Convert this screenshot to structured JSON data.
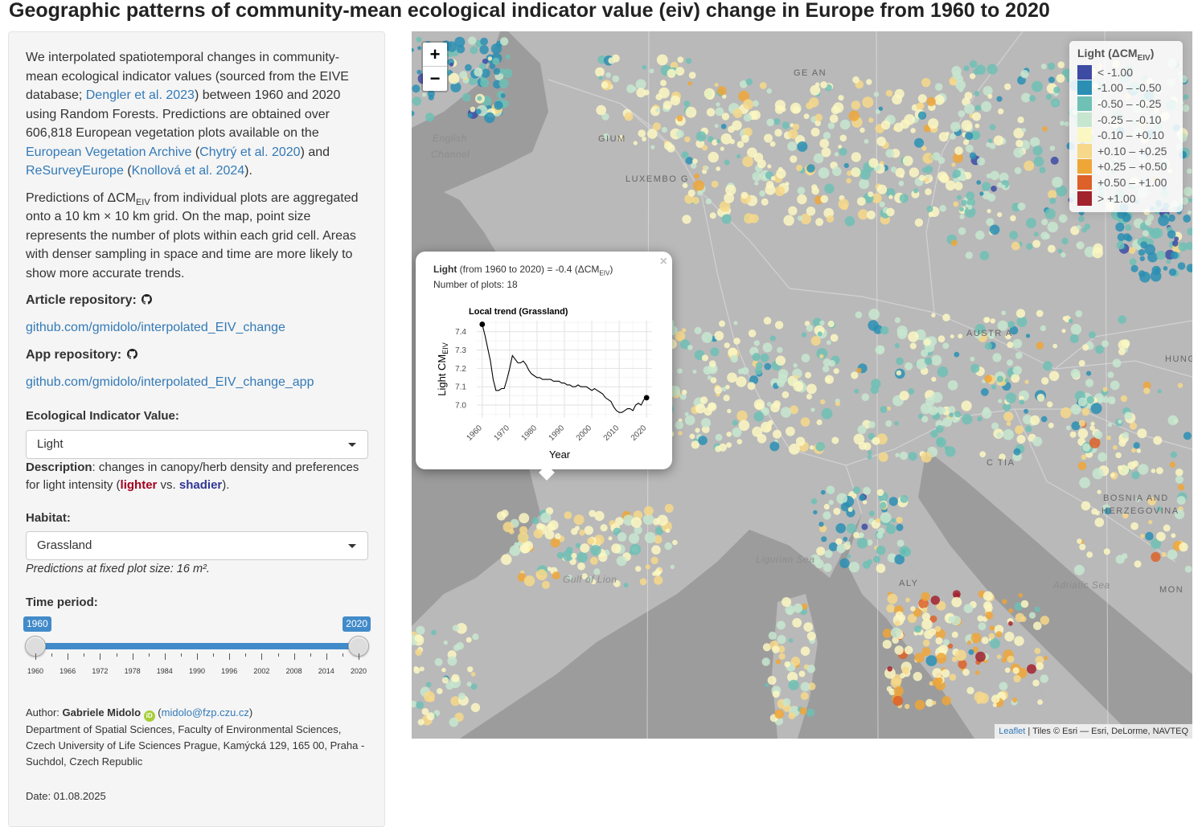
{
  "page": {
    "title": "Geographic patterns of community-mean ecological indicator value (eiv) change in Europe from 1960 to 2020"
  },
  "sidebar": {
    "intro": {
      "t1": "We interpolated spatiotemporal changes in community-mean ecological indicator values (sourced from the EIVE database; ",
      "link_dengler": "Dengler et al. 2023",
      "t2": ") between 1960 and 2020 using Random Forests. Predictions are obtained over 606,818 European vegetation plots available on the ",
      "link_eva": "European Vegetation Archive",
      "t3": " (",
      "link_chytry": "Chytrý et al. 2020",
      "t4": ") and ",
      "link_resurvey": "ReSurveyEurope",
      "t5": " (",
      "link_knollova": "Knollová et al. 2024",
      "t6": ")."
    },
    "aggregation": {
      "t1": "Predictions of ΔCM",
      "sub": "EIV",
      "t2": " from individual plots are aggregated onto a 10 km × 10 km grid. On the map, point size represents the number of plots within each grid cell. Areas with denser sampling in space and time are more likely to show more accurate trends."
    },
    "article_repo_label": "Article repository",
    "article_repo_link": "github.com/gmidolo/interpolated_EIV_change",
    "app_repo_label": "App repository",
    "app_repo_link": "github.com/gmidolo/interpolated_EIV_change_app",
    "eiv_label": "Ecological Indicator Value:",
    "eiv_selected": "Light",
    "description": {
      "label": "Description",
      "t1": ": changes in canopy/herb density and preferences for light intensity (",
      "lighter": "lighter",
      "vs": " vs. ",
      "shadier": "shadier",
      "end": ")."
    },
    "habitat_label": "Habitat:",
    "habitat_selected": "Grassland",
    "fixed_size_note": "Predictions at fixed plot size: 16 m².",
    "time_label": "Time period:",
    "slider": {
      "min": 1960,
      "max": 2020,
      "from_label": "1960",
      "to_label": "2020",
      "ticks": [
        "1960",
        "1966",
        "1972",
        "1978",
        "1984",
        "1990",
        "1996",
        "2002",
        "2008",
        "2014",
        "2020"
      ]
    },
    "author": {
      "prefix": "Author: ",
      "name": "Gabriele Midolo",
      "orcid": "iD",
      "email_open": " (",
      "email": "midolo@fzp.czu.cz",
      "email_close": ")",
      "affiliation": "Department of Spatial Sciences, Faculty of Environmental Sciences, Czech University of Life Sciences Prague, Kamýcká 129, 165 00, Praha - Suchdol, Czech Republic"
    },
    "date": "Date: 01.08.2025"
  },
  "map": {
    "zoom_in": "+",
    "zoom_out": "−",
    "sea_labels": {
      "english_channel_1": "English",
      "english_channel_2": "Channel",
      "ligurian": "Ligurian Sea",
      "gulf_lion": "Gulf of Lion",
      "adriatic": "Adriatic Sea"
    },
    "country_labels": {
      "germany": "GE    AN",
      "belgium": "   GIUM",
      "luxembourg": "LUXEMBO  G",
      "austria": "AUSTR A",
      "hungary": "HUNG",
      "croatia": "C   TIA",
      "bosnia_1": "BOSNIA AND",
      "bosnia_2": "HERZEGOVINA",
      "italy": "   ALY",
      "montenegro": "MON"
    },
    "attribution": {
      "leaflet": "Leaflet",
      "rest": " | Tiles © Esri — Esri, DeLorme, NAVTEQ"
    }
  },
  "legend": {
    "title": "Light (ΔCM",
    "title_sub": "EIV",
    "title_end": ")",
    "items": [
      {
        "label": "< -1.00",
        "color": "#3d4ba3"
      },
      {
        "label": "-1.00 – -0.50",
        "color": "#2a8fb3"
      },
      {
        "label": "-0.50 – -0.25",
        "color": "#6fc0b5"
      },
      {
        "label": "-0.25 – -0.10",
        "color": "#c7e6cf"
      },
      {
        "label": "-0.10 – +0.10",
        "color": "#fbf7c2"
      },
      {
        "label": "+0.10 – +0.25",
        "color": "#f6d88a"
      },
      {
        "label": "+0.25 – +0.50",
        "color": "#eea637"
      },
      {
        "label": "+0.50 – +1.00",
        "color": "#dd6129"
      },
      {
        "label": "> +1.00",
        "color": "#a2222e"
      }
    ]
  },
  "popup": {
    "close": "×",
    "eiv_name": "Light",
    "line1_mid": " (from 1960 to 2020) = -0.4 (ΔCM",
    "line1_sub": "EIV",
    "line1_end": ")",
    "line2": "Number of plots: 18"
  },
  "chart_data": {
    "type": "line",
    "title": "Local trend (Grassland)",
    "xlabel": "Year",
    "ylabel": "Light CM",
    "ylabel_sub": "EIV",
    "xlim": [
      1958,
      2022
    ],
    "ylim": [
      6.93,
      7.46
    ],
    "x_ticks": [
      1960,
      1970,
      1980,
      1990,
      2000,
      2010,
      2020
    ],
    "y_ticks": [
      7.0,
      7.1,
      7.2,
      7.3,
      7.4
    ],
    "x": [
      1960,
      1961,
      1962,
      1963,
      1964,
      1965,
      1966,
      1967,
      1968,
      1969,
      1970,
      1971,
      1972,
      1973,
      1974,
      1975,
      1976,
      1977,
      1978,
      1979,
      1980,
      1981,
      1982,
      1983,
      1984,
      1985,
      1986,
      1987,
      1988,
      1989,
      1990,
      1991,
      1992,
      1993,
      1994,
      1995,
      1996,
      1997,
      1998,
      1999,
      2000,
      2001,
      2002,
      2003,
      2004,
      2005,
      2006,
      2007,
      2008,
      2009,
      2010,
      2011,
      2012,
      2013,
      2014,
      2015,
      2016,
      2017,
      2018,
      2019,
      2020
    ],
    "y": [
      7.44,
      7.38,
      7.31,
      7.24,
      7.14,
      7.08,
      7.08,
      7.09,
      7.09,
      7.14,
      7.2,
      7.27,
      7.25,
      7.23,
      7.23,
      7.24,
      7.22,
      7.19,
      7.17,
      7.16,
      7.15,
      7.15,
      7.14,
      7.14,
      7.14,
      7.14,
      7.13,
      7.13,
      7.13,
      7.12,
      7.12,
      7.11,
      7.11,
      7.1,
      7.1,
      7.11,
      7.1,
      7.1,
      7.1,
      7.09,
      7.08,
      7.09,
      7.08,
      7.07,
      7.06,
      7.04,
      7.03,
      7.02,
      6.99,
      6.97,
      6.96,
      6.96,
      6.97,
      6.98,
      6.98,
      6.97,
      7.0,
      7.01,
      7.0,
      7.03,
      7.04
    ],
    "endpoints": [
      [
        1960,
        7.44
      ],
      [
        2020,
        7.04
      ]
    ]
  }
}
